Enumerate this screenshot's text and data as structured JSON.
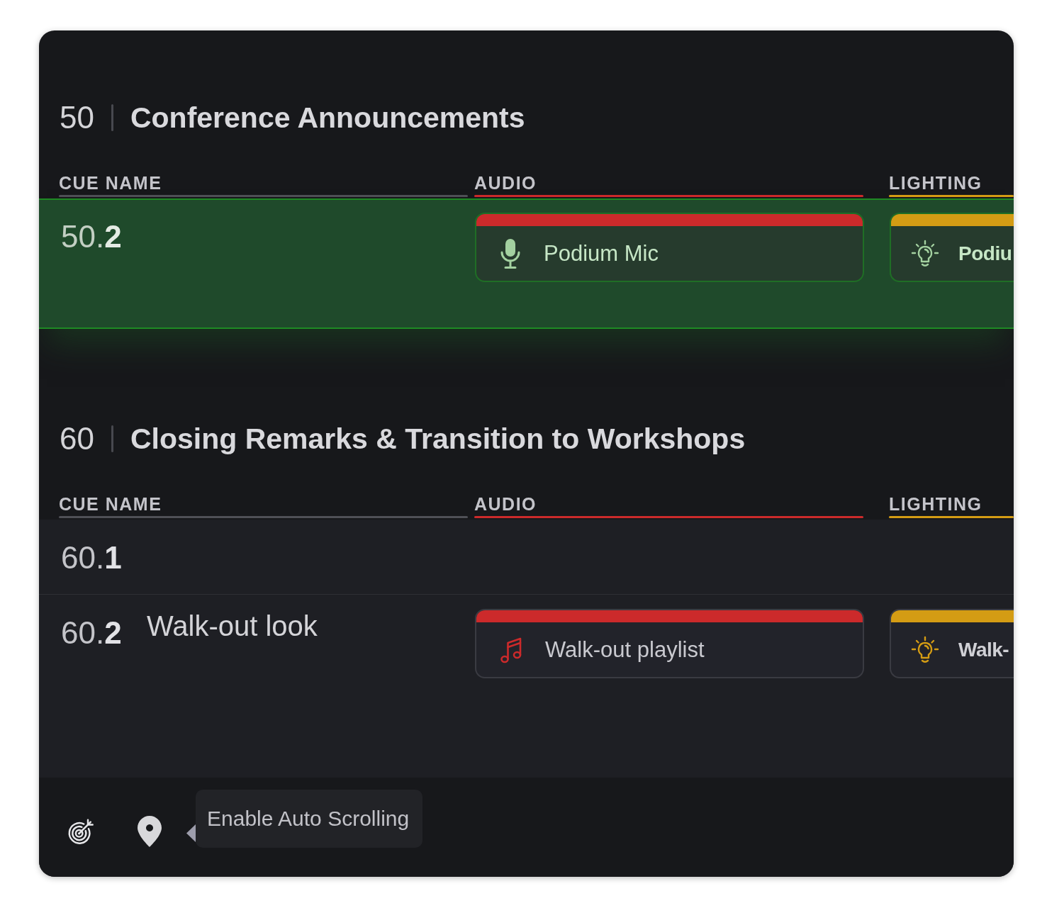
{
  "sections": [
    {
      "number": "50",
      "title": "Conference Announcements",
      "columns": [
        {
          "label": "CUE NAME",
          "color": "#4f5056"
        },
        {
          "label": "AUDIO",
          "color": "#cc2a2b"
        },
        {
          "label": "LIGHTING",
          "color": "#d49c14"
        }
      ],
      "rows": [
        {
          "number": "50.**2**",
          "selected": true,
          "cards": [
            {
              "kind": "mic",
              "label": "Podium Mic"
            },
            {
              "kind": "light",
              "label": "Podiu"
            }
          ]
        }
      ]
    },
    {
      "number": "60",
      "title": "Closing Remarks & Transition to Workshops",
      "columns": [
        {
          "label": "CUE NAME",
          "color": "#4f5056"
        },
        {
          "label": "AUDIO",
          "color": "#cc2a2b"
        },
        {
          "label": "LIGHTING",
          "color": "#d49c14"
        }
      ],
      "rows": [
        {
          "number": "60.**1**",
          "selected": false
        },
        {
          "number": "60.**2**",
          "name": "Walk-out look",
          "selected": false,
          "cards": [
            {
              "kind": "playlist",
              "label": "Walk-out playlist"
            },
            {
              "kind": "light",
              "label": "Walk-"
            }
          ]
        }
      ]
    }
  ],
  "toolbar": {
    "tooltip": "Enable Auto Scrolling"
  }
}
